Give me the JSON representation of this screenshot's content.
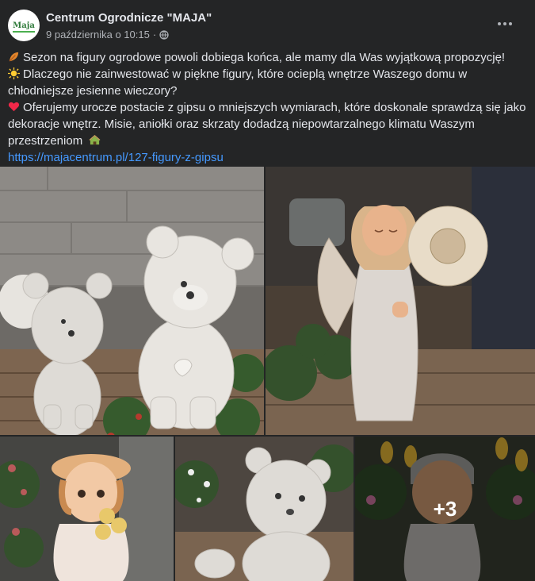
{
  "page": {
    "name": "Centrum Ogrodnicze \"MAJA\"",
    "avatar_text": "Maja",
    "date": "9 października o 10:15",
    "separator": "·",
    "privacy_icon": "globe-icon",
    "more_icon": "more-options-icon"
  },
  "post": {
    "line1": "Sezon na figury ogrodowe powoli dobiega końca, ale mamy dla Was wyjątkową propozycję!",
    "line2": "Dlaczego nie zainwestować w piękne figury, które ocieplą wnętrze Waszego domu w chłodniejsze jesienne wieczory?",
    "line3": "Oferujemy urocze postacie z gipsu o mniejszych wymiarach, które doskonale sprawdzą się jako dekoracje wnętrz. Misie, aniołki oraz skrzaty dodadzą niepowtarzalnego klimatu Waszym przestrzeniom",
    "link": "https://majacentrum.pl/127-figury-z-gipsu",
    "emojis": [
      "leaf-emoji",
      "sun-emoji",
      "heart-emoji",
      "house-emoji"
    ]
  },
  "gallery": {
    "more_count": "+3",
    "colors": {
      "link": "#4599ff",
      "background": "#242526",
      "secondary_text": "#b0b3b8"
    }
  }
}
